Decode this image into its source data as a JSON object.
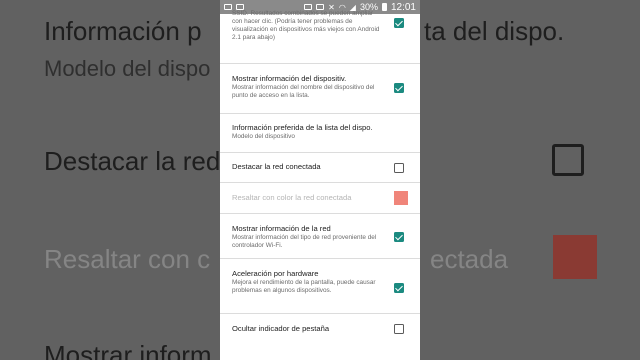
{
  "background": {
    "line1": "Información p",
    "line1b": "ta del dispo.",
    "line2": "Modelo del dispo",
    "line3": "Destacar la red",
    "line4": "Resaltar con c",
    "line4b": "ectada",
    "line5": "Mostrar inform"
  },
  "status_bar": {
    "battery": "30%",
    "time": "12:01"
  },
  "settings": [
    {
      "title": "",
      "summary": "SSID. Resultados combinados se pueden ampliar con hacer clic. (Podría tener problemas de visualización en dispositivos más viejos con Android 2.1 para abajo)",
      "control": "checkbox",
      "checked": true
    },
    {
      "title": "Mostrar información del dispositiv.",
      "summary": "Mostrar información del nombre del dispositivo del punto de acceso en la lista.",
      "control": "checkbox",
      "checked": true
    },
    {
      "title": "Información preferida de la lista del dispo.",
      "summary": "Modelo del dispositivo",
      "control": "none"
    },
    {
      "title": "Destacar la red conectada",
      "summary": "",
      "control": "checkbox",
      "checked": false
    },
    {
      "title": "Resaltar con color la red conectada",
      "summary": "",
      "control": "color",
      "disabled": true,
      "color": "#f0857a"
    },
    {
      "title": "Mostrar información de la red",
      "summary": "Mostrar información del tipo de red proveniente del controlador Wi-Fi.",
      "control": "checkbox",
      "checked": true
    },
    {
      "title": "Aceleración por hardware",
      "summary": "Mejora el rendimiento de la pantalla, puede causar problemas en algunos dispositivos.",
      "control": "checkbox",
      "checked": true
    },
    {
      "title": "Ocultar indicador de pestaña",
      "summary": "",
      "control": "checkbox",
      "checked": false
    }
  ],
  "colors": {
    "accent": "#1b8a80",
    "highlight": "#f0857a"
  }
}
